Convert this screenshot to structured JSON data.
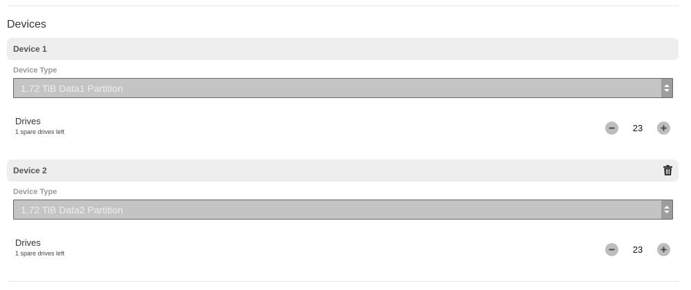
{
  "section": {
    "title": "Devices"
  },
  "devices": [
    {
      "title": "Device 1",
      "device_type_label": "Device Type",
      "device_type_value": "1.72 TiB Data1 Partition",
      "drives_label": "Drives",
      "drives_sub": "1 spare drives left",
      "drives_count": "23",
      "deletable": false
    },
    {
      "title": "Device 2",
      "device_type_label": "Device Type",
      "device_type_value": "1.72 TiB Data2 Partition",
      "drives_label": "Drives",
      "drives_sub": "1 spare drives left",
      "drives_count": "23",
      "deletable": true
    }
  ],
  "icons": {
    "delete": "trash-icon",
    "decrement": "minus-icon",
    "increment": "plus-icon",
    "select": "updown-arrows-icon"
  },
  "colors": {
    "header_bg": "#eeeeee",
    "select_bg": "#c4c4c4",
    "stepper_bg": "#bdbdbd"
  }
}
